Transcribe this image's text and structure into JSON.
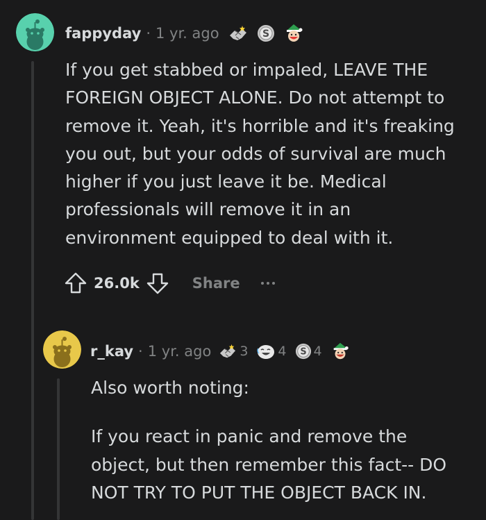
{
  "comment1": {
    "username": "fappyday",
    "separator": "·",
    "time": "1 yr. ago",
    "awards": [
      {
        "icon": "wholesome-handshake-icon"
      },
      {
        "icon": "silver-s-coin-icon"
      },
      {
        "icon": "elf-face-icon"
      }
    ],
    "body": "If you get stabbed or impaled, LEAVE THE FOREIGN OBJECT ALONE. Do not attempt to remove it. Yeah, it's horrible and it's freaking you out, but your odds of survival are much higher if you just leave it be. Medical professionals will remove it in an environment equipped to deal with it.",
    "votes": "26.0k",
    "share_label": "Share",
    "avatar_color": "#58d1ad"
  },
  "comment2": {
    "username": "r_kay",
    "separator": "·",
    "time": "1 yr. ago",
    "awards": [
      {
        "icon": "wholesome-handshake-icon",
        "count": "3"
      },
      {
        "icon": "laughing-face-icon",
        "count": "4"
      },
      {
        "icon": "silver-s-coin-icon",
        "count": "4"
      },
      {
        "icon": "elf-face-icon"
      }
    ],
    "paragraphs": [
      "Also worth noting:",
      "If you react in panic and remove the object, but then remember this fact-- DO NOT TRY TO PUT THE OBJECT BACK IN."
    ],
    "avatar_color": "#e8c84a"
  },
  "colors": {
    "background": "#1a1a1b",
    "text": "#d7dadc",
    "muted": "#818384",
    "thread_line": "#343536"
  }
}
